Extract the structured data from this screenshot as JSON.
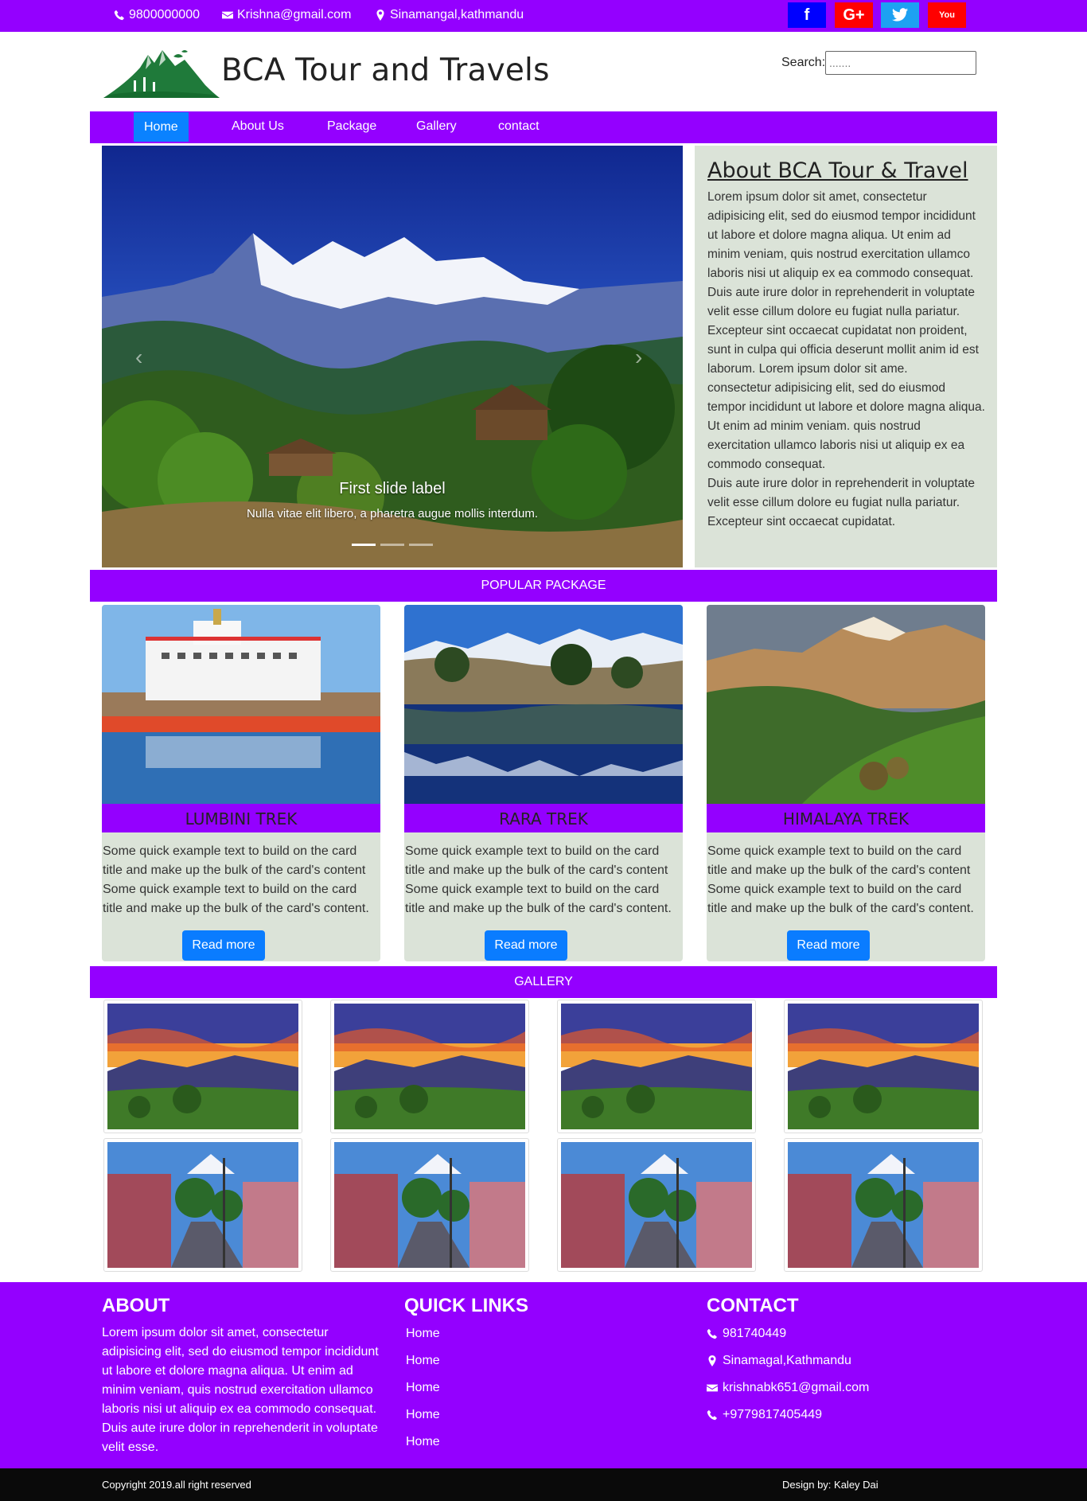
{
  "topbar": {
    "phone": "9800000000",
    "email": "Krishna@gmail.com",
    "location": "Sinamangal,kathmandu",
    "social": [
      {
        "label": "f",
        "color": "#0000ff"
      },
      {
        "label": "G+",
        "color": "#ff0000"
      },
      {
        "label": "t",
        "color": "#1da1f2"
      },
      {
        "label": "You",
        "color": "#ff0000"
      }
    ]
  },
  "header": {
    "title": "BCA Tour and Travels",
    "search_label": "Search:",
    "search_placeholder": "......."
  },
  "nav": {
    "items": [
      "Home",
      "About Us",
      "Package",
      "Gallery",
      "contact"
    ],
    "active": "Home"
  },
  "carousel": {
    "caption_title": "First slide label",
    "caption_text": "Nulla vitae elit libero, a pharetra augue mollis interdum.",
    "prev": "‹",
    "next": "›"
  },
  "about": {
    "title": "About BCA Tour & Travel",
    "p1": "Lorem ipsum dolor sit amet, consectetur adipisicing elit, sed do eiusmod tempor incididunt ut labore et dolore magna aliqua. Ut enim ad minim veniam, quis nostrud exercitation ullamco laboris nisi ut aliquip ex ea commodo consequat. Duis aute irure dolor in reprehenderit in voluptate velit esse cillum dolore eu fugiat nulla pariatur. Excepteur sint occaecat cupidatat non proident, sunt in culpa qui officia deserunt mollit anim id est laborum. Lorem ipsum dolor sit ame.",
    "p2": "consectetur adipisicing elit, sed do eiusmod tempor incididunt ut labore et dolore magna aliqua. Ut enim ad minim veniam. quis nostrud exercitation ullamco laboris nisi ut aliquip ex ea commodo consequat.",
    "p3": "Duis aute irure dolor in reprehenderit in voluptate velit esse cillum dolore eu fugiat nulla pariatur. Excepteur sint occaecat cupidatat."
  },
  "popular": {
    "heading": "POPULAR PACKAGE",
    "cards": [
      {
        "title": "LUMBINI TREK",
        "text": "Some quick example text to build on the card title and make up the bulk of the card's content Some quick example text to build on the card title and make up the bulk of the card's content.",
        "button": "Read more"
      },
      {
        "title": "RARA TREK",
        "text": "Some quick example text to build on the card title and make up the bulk of the card's content Some quick example text to build on the card title and make up the bulk of the card's content.",
        "button": "Read more"
      },
      {
        "title": "HIMALAYA TREK",
        "text": "Some quick example text to build on the card title and make up the bulk of the card's content Some quick example text to build on the card title and make up the bulk of the card's content.",
        "button": "Read more"
      }
    ]
  },
  "gallery": {
    "heading": "GALLERY"
  },
  "footer": {
    "about_title": "ABOUT",
    "about_text": "Lorem ipsum dolor sit amet, consectetur adipisicing elit, sed do eiusmod tempor incididunt ut labore et dolore magna aliqua. Ut enim ad minim veniam, quis nostrud exercitation ullamco laboris nisi ut aliquip ex ea commodo consequat. Duis aute irure dolor in reprehenderit in voluptate velit esse.",
    "links_title": "QUICK LINKS",
    "links": [
      "Home",
      "Home",
      "Home",
      "Home",
      "Home"
    ],
    "contact_title": "CONTACT",
    "contact": {
      "phone1": "981740449",
      "address": "Sinamagal,Kathmandu",
      "email": "krishnabk651@gmail.com",
      "phone2": "+9779817405449"
    },
    "copyright": "Copyright 2019.all right reserved",
    "design": "Design by: Kaley Dai"
  }
}
